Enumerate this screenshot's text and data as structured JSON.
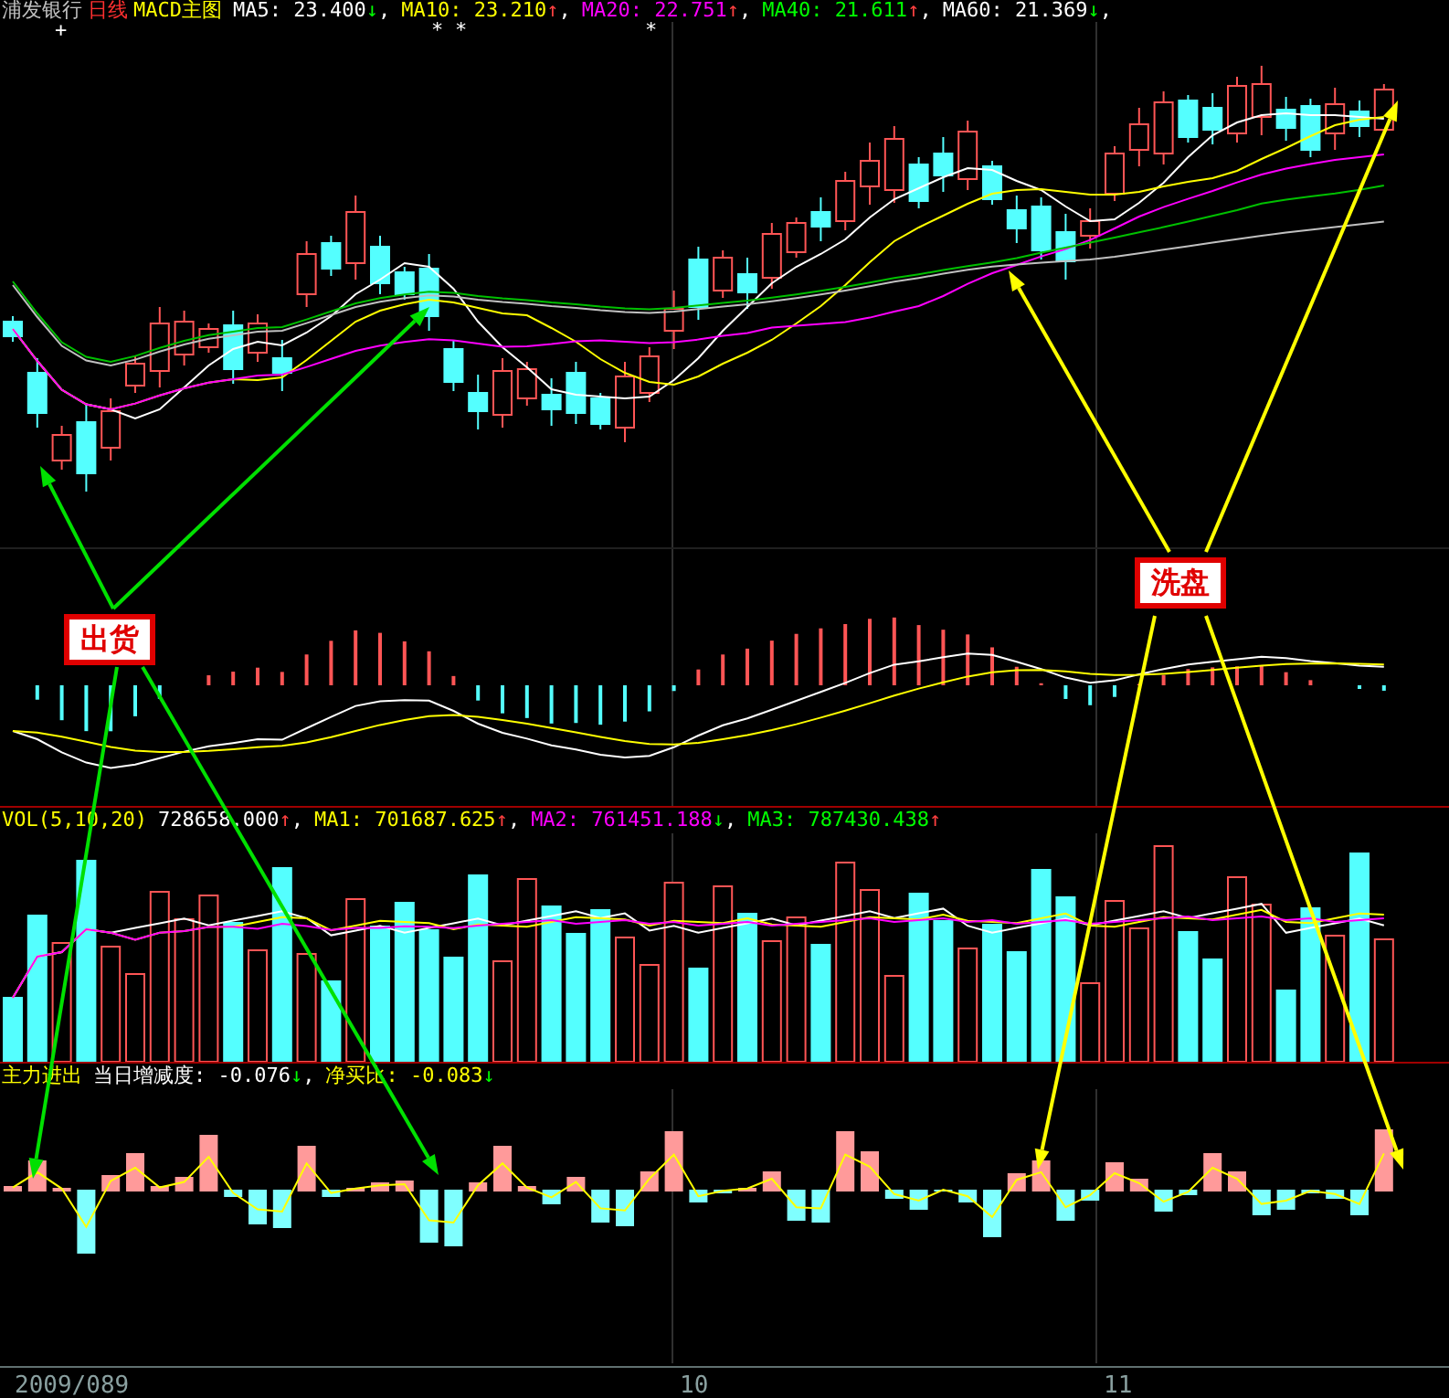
{
  "header": {
    "stock": "浦发银行",
    "period": "日线",
    "indicator": "MACD主图",
    "items": [
      {
        "label": "MA5: 23.400",
        "color": "#ffffff",
        "arrow": {
          "symbol": "↓",
          "color": "#00ff00"
        },
        "sep": ","
      },
      {
        "label": "MA10: 23.210",
        "color": "#ffff00",
        "arrow": {
          "symbol": "↑",
          "color": "#ff4040"
        },
        "sep": ","
      },
      {
        "label": "MA20: 22.751",
        "color": "#ff00ff",
        "arrow": {
          "symbol": "↑",
          "color": "#ff4040"
        },
        "sep": ","
      },
      {
        "label": "MA40: 21.611",
        "color": "#00ff00",
        "arrow": {
          "symbol": "↑",
          "color": "#ff4040"
        },
        "sep": ","
      },
      {
        "label": "MA60: 21.369",
        "color": "#ffffff",
        "arrow": {
          "symbol": "↓",
          "color": "#00ff00"
        },
        "sep": ","
      }
    ]
  },
  "price_markers": [
    "+",
    "*",
    "*",
    "*"
  ],
  "volume_header": {
    "title": "VOL(5,10,20)",
    "items": [
      {
        "label": "728658.000",
        "color": "#ffffff",
        "arrow": {
          "symbol": "↑",
          "color": "#ff4040"
        },
        "sep": ","
      },
      {
        "label": "MA1: 701687.625",
        "color": "#ffff00",
        "arrow": {
          "symbol": "↑",
          "color": "#ff4040"
        },
        "sep": ","
      },
      {
        "label": "MA2: 761451.188",
        "color": "#ff00ff",
        "arrow": {
          "symbol": "↓",
          "color": "#00ff00"
        },
        "sep": ","
      },
      {
        "label": "MA3: 787430.438",
        "color": "#00ff00",
        "arrow": {
          "symbol": "↑",
          "color": "#ff4040"
        }
      }
    ]
  },
  "flow_header": {
    "title": "主力进出",
    "items": [
      {
        "label": "当日增减度: -0.076",
        "color": "#ffffff",
        "arrow": {
          "symbol": "↓",
          "color": "#00ff00"
        },
        "sep": ","
      },
      {
        "label": "净买比: -0.083",
        "color": "#ffff00",
        "arrow": {
          "symbol": "↓",
          "color": "#00ff00"
        }
      }
    ]
  },
  "annotations": [
    {
      "label": "出货",
      "kind": "sell"
    },
    {
      "label": "洗盘",
      "kind": "shakeout"
    }
  ],
  "x_axis": [
    "2009/089",
    "10",
    "11"
  ]
}
